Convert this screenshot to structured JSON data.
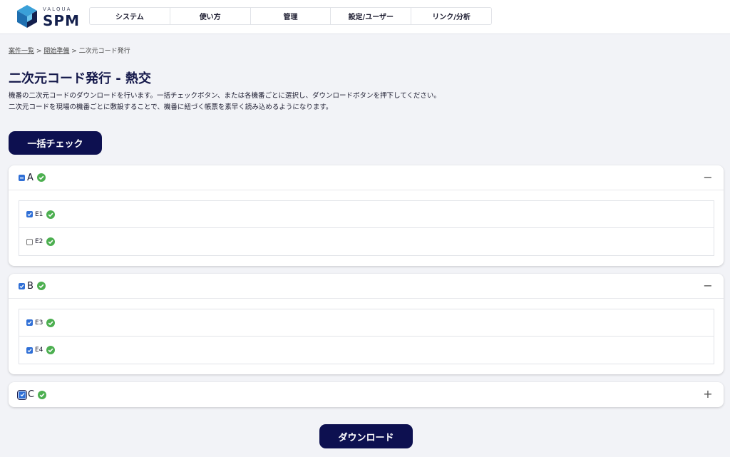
{
  "header": {
    "logo_small": "VALQUA",
    "logo_big": "SPM",
    "nav": [
      "システム",
      "使い方",
      "管理",
      "設定/ユーザー",
      "リンク/分析"
    ]
  },
  "breadcrumb": {
    "items": [
      "案件一覧",
      "開始準備",
      "二次元コード発行"
    ],
    "separator": ">"
  },
  "page": {
    "title": "二次元コード発行 - 熱交",
    "description": [
      "機番の二次元コードのダウンロードを行います。一括チェックボタン、または各機番ごとに選択し、ダウンロードボタンを押下してください。",
      "二次元コードを現場の機番ごとに敷設することで、機番に紐づく帳票を素早く読み込めるようになります。"
    ],
    "check_all_label": "一括チェック",
    "download_label": "ダウンロード"
  },
  "groups": [
    {
      "label": "A",
      "state": "indeterminate",
      "expanded": true,
      "toggle": "−",
      "items": [
        {
          "label": "E1",
          "checked": true
        },
        {
          "label": "E2",
          "checked": false
        }
      ]
    },
    {
      "label": "B",
      "state": "checked",
      "expanded": true,
      "toggle": "−",
      "items": [
        {
          "label": "E3",
          "checked": true
        },
        {
          "label": "E4",
          "checked": true
        }
      ]
    },
    {
      "label": "C",
      "state": "checked",
      "expanded": false,
      "toggle": "+",
      "items": []
    }
  ],
  "colors": {
    "brand_dark": "#0d1050",
    "checkbox": "#2f6fd6",
    "ok_green": "#4caf50"
  },
  "icons": {
    "ok": "check-circle-icon",
    "collapse": "minus-icon",
    "expand": "plus-icon"
  }
}
